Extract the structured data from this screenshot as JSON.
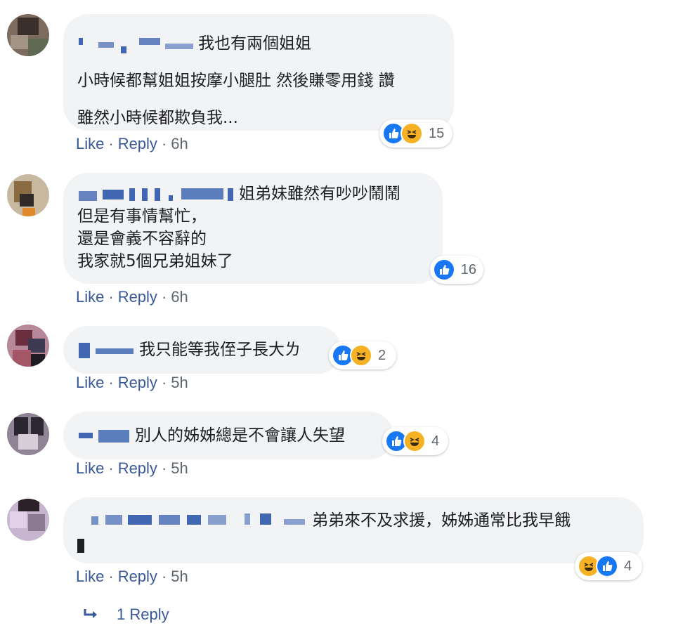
{
  "comments": [
    {
      "text_lines": [
        "我也有兩個姐姐",
        "小時候都幫姐姐按摩小腿肚 然後賺零用錢 讚",
        "雖然小時候都欺負我..."
      ],
      "like_label": "Like",
      "reply_label": "Reply",
      "time": "6h",
      "reactions": [
        "like",
        "haha"
      ],
      "reaction_count": "15"
    },
    {
      "text_lines": [
        "姐弟妹雖然有吵吵鬧鬧",
        "但是有事情幫忙，",
        "還是會義不容辭的",
        "我家就5個兄弟姐妹了"
      ],
      "like_label": "Like",
      "reply_label": "Reply",
      "time": "6h",
      "reactions": [
        "like"
      ],
      "reaction_count": "16"
    },
    {
      "text_lines": [
        "我只能等我侄子長大ㄌ"
      ],
      "like_label": "Like",
      "reply_label": "Reply",
      "time": "5h",
      "reactions": [
        "like",
        "haha"
      ],
      "reaction_count": "2"
    },
    {
      "text_lines": [
        "別人的姊姊總是不會讓人失望"
      ],
      "like_label": "Like",
      "reply_label": "Reply",
      "time": "5h",
      "reactions": [
        "like",
        "haha"
      ],
      "reaction_count": "4"
    },
    {
      "text_lines": [
        "弟弟來不及求援，姊姊通常比我早餓"
      ],
      "like_label": "Like",
      "reply_label": "Reply",
      "time": "5h",
      "reactions": [
        "haha",
        "like"
      ],
      "reaction_count": "4"
    }
  ],
  "replies_link": {
    "label": "1 Reply",
    "icon": "reply-arrow-icon"
  },
  "colors": {
    "link": "#385898",
    "bubble": "#f2f3f5",
    "like": "#1877f2",
    "haha": "#f7b125",
    "meta": "#606770"
  }
}
